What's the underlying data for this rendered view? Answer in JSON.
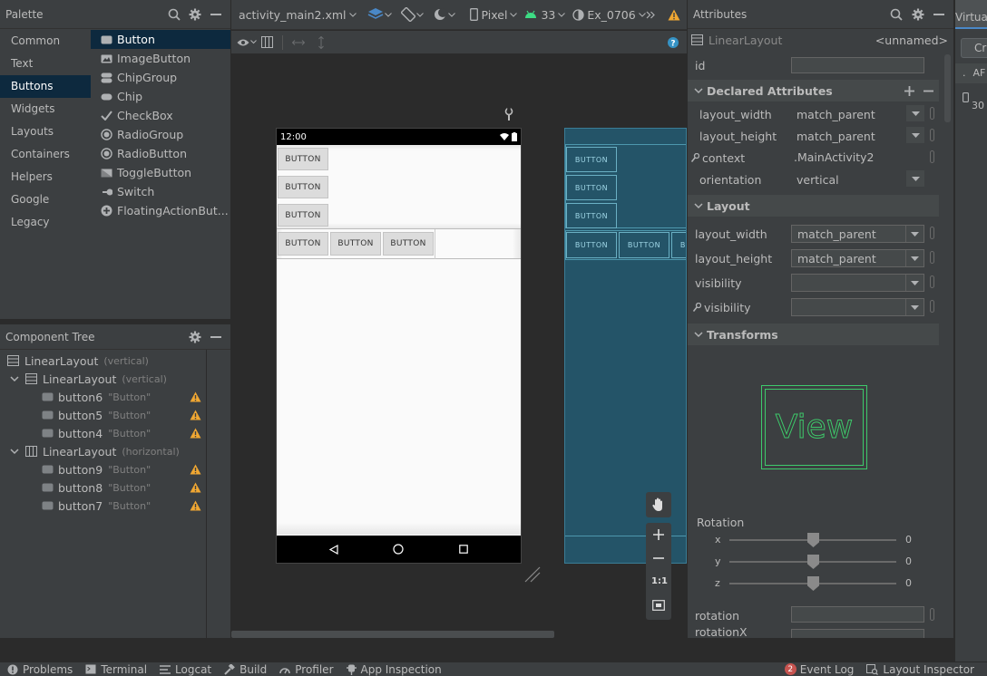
{
  "palette": {
    "title": "Palette",
    "categories": [
      "Common",
      "Text",
      "Buttons",
      "Widgets",
      "Layouts",
      "Containers",
      "Helpers",
      "Google",
      "Legacy"
    ],
    "items": [
      "Button",
      "ImageButton",
      "ChipGroup",
      "Chip",
      "CheckBox",
      "RadioGroup",
      "RadioButton",
      "ToggleButton",
      "Switch",
      "FloatingActionBut..."
    ]
  },
  "tree": {
    "title": "Component Tree",
    "root": {
      "label": "LinearLayout",
      "sub": "(vertical)"
    },
    "group1": {
      "label": "LinearLayout",
      "sub": "(vertical)"
    },
    "group2": {
      "label": "LinearLayout",
      "sub": "(horizontal)"
    },
    "buttons1": [
      {
        "id": "button6",
        "text": "\"Button\""
      },
      {
        "id": "button5",
        "text": "\"Button\""
      },
      {
        "id": "button4",
        "text": "\"Button\""
      }
    ],
    "buttons2": [
      {
        "id": "button9",
        "text": "\"Button\""
      },
      {
        "id": "button8",
        "text": "\"Button\""
      },
      {
        "id": "button7",
        "text": "\"Button\""
      }
    ]
  },
  "toolbar": {
    "file": "activity_main2.xml",
    "device": "Pixel",
    "api": "33",
    "theme": "Ex_0706"
  },
  "phone": {
    "time": "12:00",
    "button_label": "BUTTON"
  },
  "zoom": {
    "ratio": "1:1"
  },
  "attributes": {
    "title": "Attributes",
    "view_type": "LinearLayout",
    "view_name": "<unnamed>",
    "id_label": "id",
    "declared_title": "Declared Attributes",
    "declared": [
      {
        "name": "layout_width",
        "value": "match_parent"
      },
      {
        "name": "layout_height",
        "value": "match_parent"
      },
      {
        "name": "context",
        "value": ".MainActivity2"
      },
      {
        "name": "orientation",
        "value": "vertical"
      }
    ],
    "layout_title": "Layout",
    "layout": [
      {
        "name": "layout_width",
        "value": "match_parent"
      },
      {
        "name": "layout_height",
        "value": "match_parent"
      },
      {
        "name": "visibility",
        "value": ""
      },
      {
        "name": "visibility",
        "value": ""
      }
    ],
    "transforms_title": "Transforms",
    "preview_text": "View",
    "rotation_title": "Rotation",
    "rotation": [
      {
        "axis": "x",
        "value": "0"
      },
      {
        "axis": "y",
        "value": "0"
      },
      {
        "axis": "z",
        "value": "0"
      }
    ],
    "extra": [
      "rotation",
      "rotationX"
    ]
  },
  "virtual": {
    "title": "Virtual",
    "btn1": "Cr",
    "btn2": "AF",
    "num": "30"
  },
  "bottombar": {
    "left": [
      "Problems",
      "Terminal",
      "Logcat",
      "Build",
      "Profiler",
      "App Inspection"
    ],
    "event_count": "2",
    "event_log": "Event Log",
    "layout_inspector": "Layout Inspector"
  },
  "colors": {
    "accent": "#0d293e",
    "warning": "#f0a732",
    "blueprint": "#245468",
    "preview_green": "#3ec96b"
  }
}
